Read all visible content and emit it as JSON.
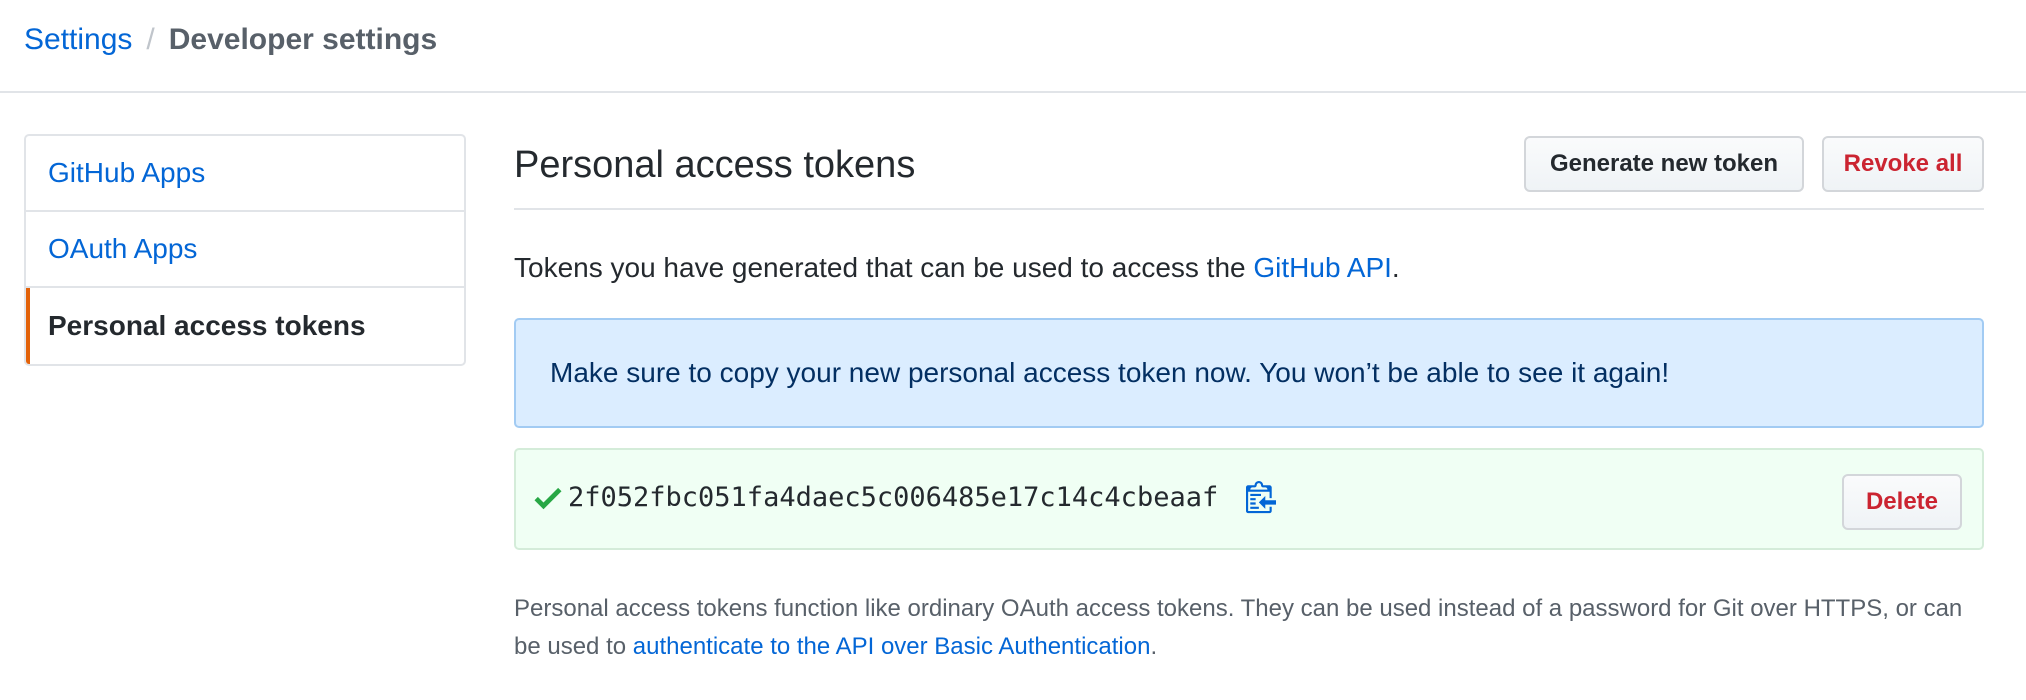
{
  "breadcrumb": {
    "parent": "Settings",
    "separator": "/",
    "current": "Developer settings"
  },
  "sidebar": {
    "items": [
      {
        "label": "GitHub Apps",
        "selected": false
      },
      {
        "label": "OAuth Apps",
        "selected": false
      },
      {
        "label": "Personal access tokens",
        "selected": true
      }
    ]
  },
  "main": {
    "title": "Personal access tokens",
    "generate_button": "Generate new token",
    "revoke_button": "Revoke all",
    "intro_text": "Tokens you have generated that can be used to access the ",
    "intro_link": "GitHub API",
    "intro_end": ".",
    "flash_message": "Make sure to copy your new personal access token now. You won’t be able to see it again!",
    "token": {
      "value": "2f052fbc051fa4daec5c006485e17c14c4cbeaaf",
      "delete_button": "Delete",
      "check_icon": "check-icon",
      "copy_icon": "clipboard-icon"
    },
    "note_text": "Personal access tokens function like ordinary OAuth access tokens. They can be used instead of a password for Git over HTTPS, or can be used to ",
    "note_link": "authenticate to the API over Basic Authentication",
    "note_end": "."
  },
  "colors": {
    "link": "#0366d6",
    "danger": "#cb2431",
    "selected_accent": "#e36209",
    "flash_bg": "#dbedff",
    "token_bg": "#f0fff4",
    "success": "#28a745"
  }
}
